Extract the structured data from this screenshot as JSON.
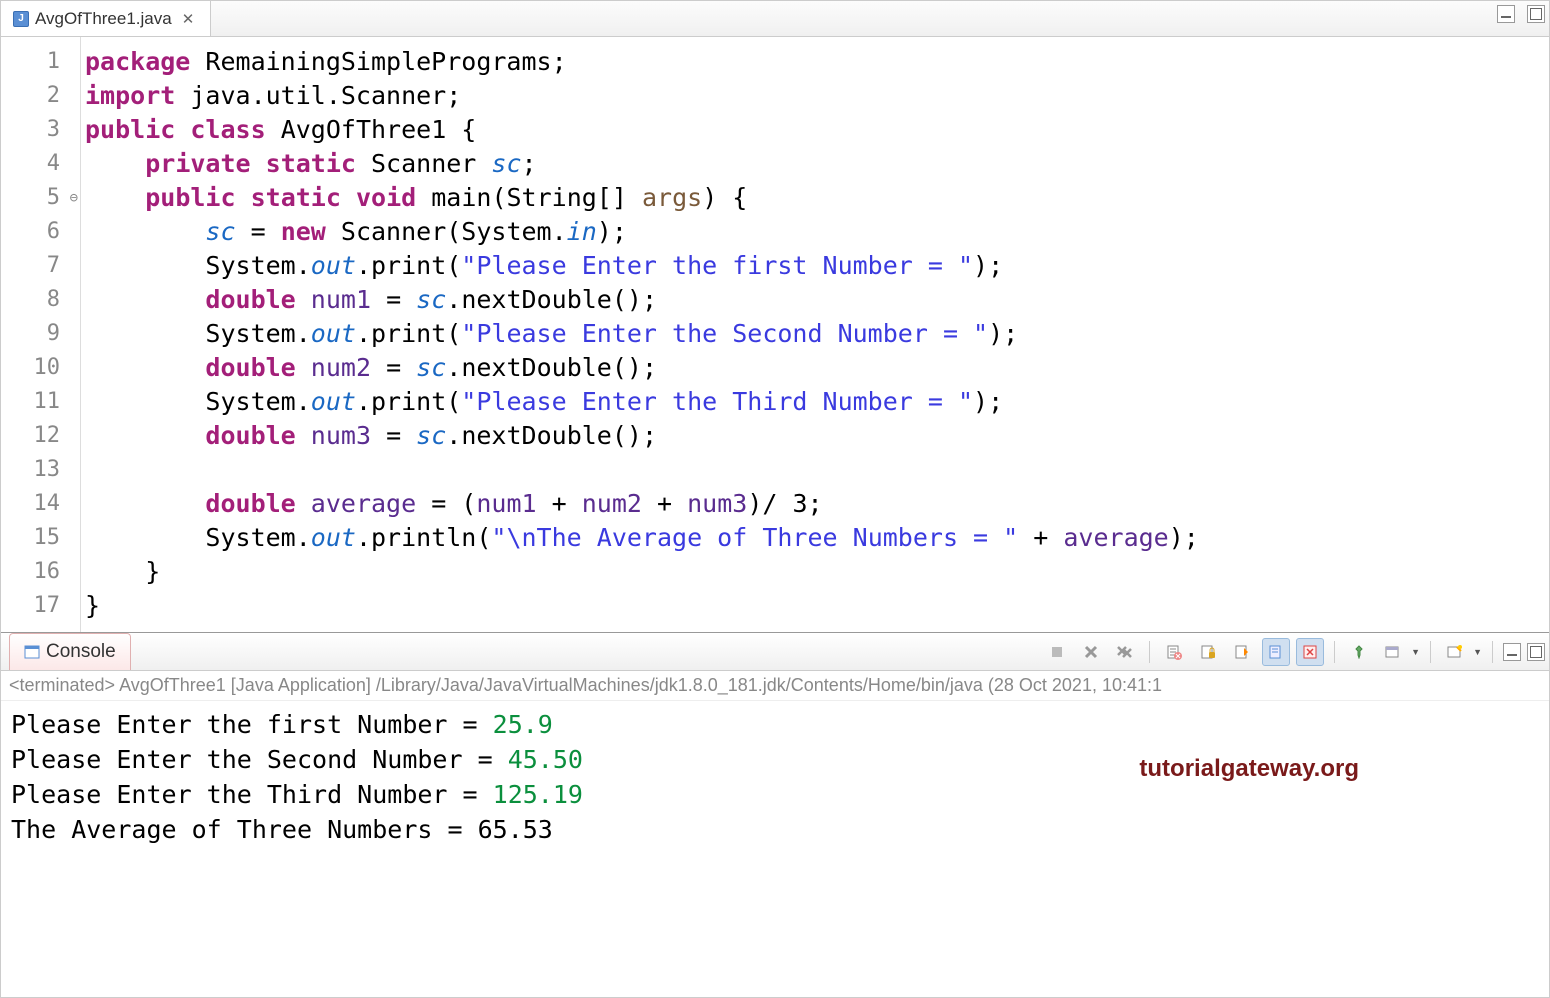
{
  "tab": {
    "filename": "AvgOfThree1.java",
    "icon_letter": "J"
  },
  "code": {
    "lines": {
      "1": [
        {
          "cls": "kw",
          "t": "package"
        },
        {
          "cls": "",
          "t": " RemainingSimplePrograms;"
        }
      ],
      "2": [
        {
          "cls": "kw",
          "t": "import"
        },
        {
          "cls": "",
          "t": " java.util.Scanner;"
        }
      ],
      "3": [
        {
          "cls": "kw",
          "t": "public"
        },
        {
          "cls": "",
          "t": " "
        },
        {
          "cls": "kw",
          "t": "class"
        },
        {
          "cls": "",
          "t": " AvgOfThree1 {"
        }
      ],
      "4": [
        {
          "cls": "",
          "t": "    "
        },
        {
          "cls": "kw",
          "t": "private"
        },
        {
          "cls": "",
          "t": " "
        },
        {
          "cls": "kw",
          "t": "static"
        },
        {
          "cls": "",
          "t": " Scanner "
        },
        {
          "cls": "static-field",
          "t": "sc"
        },
        {
          "cls": "",
          "t": ";"
        }
      ],
      "5": [
        {
          "cls": "",
          "t": "    "
        },
        {
          "cls": "kw",
          "t": "public"
        },
        {
          "cls": "",
          "t": " "
        },
        {
          "cls": "kw",
          "t": "static"
        },
        {
          "cls": "",
          "t": " "
        },
        {
          "cls": "kw",
          "t": "void"
        },
        {
          "cls": "",
          "t": " main(String[] "
        },
        {
          "cls": "param",
          "t": "args"
        },
        {
          "cls": "",
          "t": ") {"
        }
      ],
      "6": [
        {
          "cls": "",
          "t": "        "
        },
        {
          "cls": "static-field",
          "t": "sc"
        },
        {
          "cls": "",
          "t": " = "
        },
        {
          "cls": "kw",
          "t": "new"
        },
        {
          "cls": "",
          "t": " Scanner(System."
        },
        {
          "cls": "static-field",
          "t": "in"
        },
        {
          "cls": "",
          "t": ");"
        }
      ],
      "7": [
        {
          "cls": "",
          "t": "        System."
        },
        {
          "cls": "static-field",
          "t": "out"
        },
        {
          "cls": "",
          "t": ".print("
        },
        {
          "cls": "str",
          "t": "\"Please Enter the first Number = \""
        },
        {
          "cls": "",
          "t": ");"
        }
      ],
      "8": [
        {
          "cls": "",
          "t": "        "
        },
        {
          "cls": "kw",
          "t": "double"
        },
        {
          "cls": "",
          "t": " "
        },
        {
          "cls": "var-field",
          "t": "num1"
        },
        {
          "cls": "",
          "t": " = "
        },
        {
          "cls": "static-field",
          "t": "sc"
        },
        {
          "cls": "",
          "t": ".nextDouble();"
        }
      ],
      "9": [
        {
          "cls": "",
          "t": "        System."
        },
        {
          "cls": "static-field",
          "t": "out"
        },
        {
          "cls": "",
          "t": ".print("
        },
        {
          "cls": "str",
          "t": "\"Please Enter the Second Number = \""
        },
        {
          "cls": "",
          "t": ");"
        }
      ],
      "10": [
        {
          "cls": "",
          "t": "        "
        },
        {
          "cls": "kw",
          "t": "double"
        },
        {
          "cls": "",
          "t": " "
        },
        {
          "cls": "var-field",
          "t": "num2"
        },
        {
          "cls": "",
          "t": " = "
        },
        {
          "cls": "static-field",
          "t": "sc"
        },
        {
          "cls": "",
          "t": ".nextDouble();"
        }
      ],
      "11": [
        {
          "cls": "",
          "t": "        System."
        },
        {
          "cls": "static-field",
          "t": "out"
        },
        {
          "cls": "",
          "t": ".print("
        },
        {
          "cls": "str",
          "t": "\"Please Enter the Third Number = \""
        },
        {
          "cls": "",
          "t": ");"
        }
      ],
      "12": [
        {
          "cls": "",
          "t": "        "
        },
        {
          "cls": "kw",
          "t": "double"
        },
        {
          "cls": "",
          "t": " "
        },
        {
          "cls": "var-field",
          "t": "num3"
        },
        {
          "cls": "",
          "t": " = "
        },
        {
          "cls": "static-field",
          "t": "sc"
        },
        {
          "cls": "",
          "t": ".nextDouble();"
        }
      ],
      "13": [
        {
          "cls": "",
          "t": ""
        }
      ],
      "14": [
        {
          "cls": "",
          "t": "        "
        },
        {
          "cls": "kw",
          "t": "double"
        },
        {
          "cls": "",
          "t": " "
        },
        {
          "cls": "var-field",
          "t": "average"
        },
        {
          "cls": "",
          "t": " = ("
        },
        {
          "cls": "var-field",
          "t": "num1"
        },
        {
          "cls": "",
          "t": " + "
        },
        {
          "cls": "var-field",
          "t": "num2"
        },
        {
          "cls": "",
          "t": " + "
        },
        {
          "cls": "var-field",
          "t": "num3"
        },
        {
          "cls": "",
          "t": ")/ 3;"
        }
      ],
      "15": [
        {
          "cls": "",
          "t": "        System."
        },
        {
          "cls": "static-field",
          "t": "out"
        },
        {
          "cls": "",
          "t": ".println("
        },
        {
          "cls": "str",
          "t": "\"\\nThe Average of Three Numbers = \""
        },
        {
          "cls": "",
          "t": " + "
        },
        {
          "cls": "var-field",
          "t": "average"
        },
        {
          "cls": "",
          "t": ");"
        }
      ],
      "16": [
        {
          "cls": "",
          "t": "    }"
        }
      ],
      "17": [
        {
          "cls": "",
          "t": "}"
        }
      ]
    },
    "line_count": 17,
    "fold_line": 5
  },
  "console": {
    "title": "Console",
    "status": "<terminated> AvgOfThree1 [Java Application] /Library/Java/JavaVirtualMachines/jdk1.8.0_181.jdk/Contents/Home/bin/java  (28 Oct 2021, 10:41:1",
    "output": [
      {
        "prompt": "Please Enter the first Number = ",
        "input": "25.9"
      },
      {
        "prompt": "Please Enter the Second Number = ",
        "input": "45.50"
      },
      {
        "prompt": "Please Enter the Third Number = ",
        "input": "125.19"
      },
      {
        "prompt": "",
        "input": ""
      },
      {
        "prompt": "The Average of Three Numbers = 65.53",
        "input": ""
      }
    ],
    "watermark": "tutorialgateway.org"
  }
}
